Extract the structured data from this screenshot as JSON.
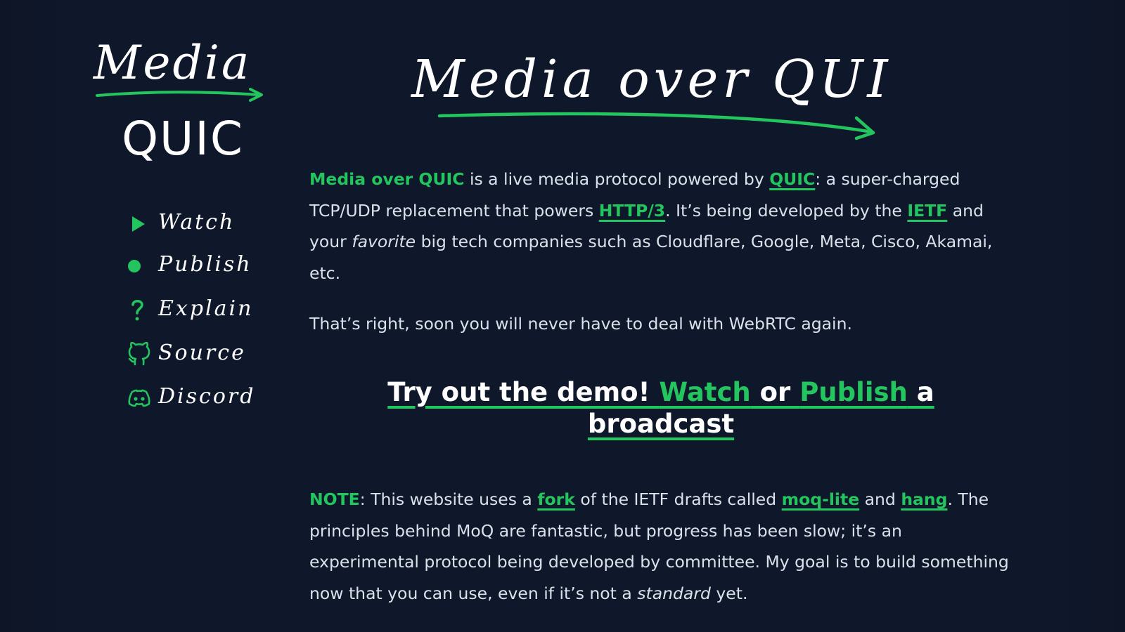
{
  "colors": {
    "background": "#0f172a",
    "accent": "#22c55e",
    "text": "#dbe1ea",
    "heading": "#ffffff"
  },
  "sidebar": {
    "logo": {
      "line1": "Media",
      "line2": "QUIC"
    },
    "nav": [
      {
        "label": "Watch",
        "icon": "play-icon"
      },
      {
        "label": "Publish",
        "icon": "record-dot-icon"
      },
      {
        "label": "Explain",
        "icon": "question-icon"
      },
      {
        "label": "Source",
        "icon": "github-icon"
      },
      {
        "label": "Discord",
        "icon": "discord-icon"
      }
    ]
  },
  "hero": {
    "title": "Media over QUIC"
  },
  "intro": {
    "brand": "Media over QUIC",
    "t1": " is a live media protocol powered by ",
    "quic_link": "QUIC",
    "t2": ": a super-charged TCP/UDP replacement that powers ",
    "http3_link": "HTTP/3",
    "t3": ". It’s being developed by the ",
    "ietf_link": "IETF",
    "t4": " and your ",
    "favorite": "favorite",
    "t5": " big tech companies such as Cloudflare, Google, Meta, Cisco, Akamai, etc."
  },
  "tagline": "That’s right, soon you will never have to deal with WebRTC again.",
  "cta": {
    "lead": "Try out the demo! ",
    "watch": "Watch",
    "or": " or ",
    "publish": "Publish",
    "tail": " a broadcast"
  },
  "note": {
    "label": "NOTE",
    "t1": ": This website uses a ",
    "fork_link": "fork",
    "t2": " of the IETF drafts called ",
    "moqlite_link": "moq-lite",
    "t3": " and ",
    "hang_link": "hang",
    "t4": ". The principles behind MoQ are fantastic, but progress has been slow; it’s an experimental protocol being developed by committee. My goal is to build something now that you can use, even if it’s not a ",
    "standard": "standard",
    "t5": " yet."
  }
}
